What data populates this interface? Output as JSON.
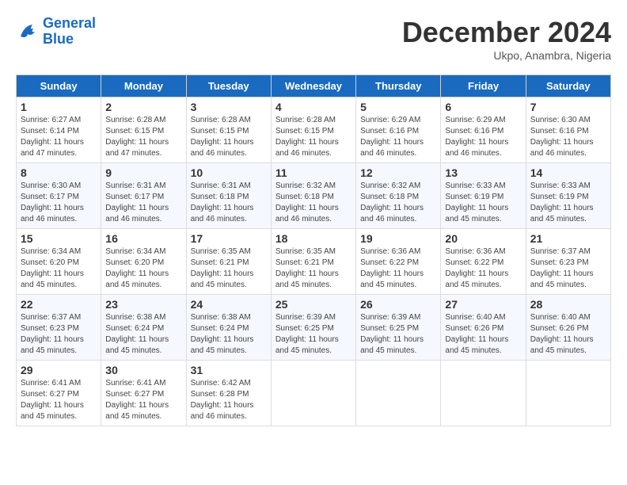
{
  "logo": {
    "line1": "General",
    "line2": "Blue"
  },
  "title": "December 2024",
  "subtitle": "Ukpo, Anambra, Nigeria",
  "weekdays": [
    "Sunday",
    "Monday",
    "Tuesday",
    "Wednesday",
    "Thursday",
    "Friday",
    "Saturday"
  ],
  "weeks": [
    [
      {
        "day": 1,
        "sunrise": "6:27 AM",
        "sunset": "6:14 PM",
        "daylight": "11 hours and 47 minutes."
      },
      {
        "day": 2,
        "sunrise": "6:28 AM",
        "sunset": "6:15 PM",
        "daylight": "11 hours and 47 minutes."
      },
      {
        "day": 3,
        "sunrise": "6:28 AM",
        "sunset": "6:15 PM",
        "daylight": "11 hours and 46 minutes."
      },
      {
        "day": 4,
        "sunrise": "6:28 AM",
        "sunset": "6:15 PM",
        "daylight": "11 hours and 46 minutes."
      },
      {
        "day": 5,
        "sunrise": "6:29 AM",
        "sunset": "6:16 PM",
        "daylight": "11 hours and 46 minutes."
      },
      {
        "day": 6,
        "sunrise": "6:29 AM",
        "sunset": "6:16 PM",
        "daylight": "11 hours and 46 minutes."
      },
      {
        "day": 7,
        "sunrise": "6:30 AM",
        "sunset": "6:16 PM",
        "daylight": "11 hours and 46 minutes."
      }
    ],
    [
      {
        "day": 8,
        "sunrise": "6:30 AM",
        "sunset": "6:17 PM",
        "daylight": "11 hours and 46 minutes."
      },
      {
        "day": 9,
        "sunrise": "6:31 AM",
        "sunset": "6:17 PM",
        "daylight": "11 hours and 46 minutes."
      },
      {
        "day": 10,
        "sunrise": "6:31 AM",
        "sunset": "6:18 PM",
        "daylight": "11 hours and 46 minutes."
      },
      {
        "day": 11,
        "sunrise": "6:32 AM",
        "sunset": "6:18 PM",
        "daylight": "11 hours and 46 minutes."
      },
      {
        "day": 12,
        "sunrise": "6:32 AM",
        "sunset": "6:18 PM",
        "daylight": "11 hours and 46 minutes."
      },
      {
        "day": 13,
        "sunrise": "6:33 AM",
        "sunset": "6:19 PM",
        "daylight": "11 hours and 45 minutes."
      },
      {
        "day": 14,
        "sunrise": "6:33 AM",
        "sunset": "6:19 PM",
        "daylight": "11 hours and 45 minutes."
      }
    ],
    [
      {
        "day": 15,
        "sunrise": "6:34 AM",
        "sunset": "6:20 PM",
        "daylight": "11 hours and 45 minutes."
      },
      {
        "day": 16,
        "sunrise": "6:34 AM",
        "sunset": "6:20 PM",
        "daylight": "11 hours and 45 minutes."
      },
      {
        "day": 17,
        "sunrise": "6:35 AM",
        "sunset": "6:21 PM",
        "daylight": "11 hours and 45 minutes."
      },
      {
        "day": 18,
        "sunrise": "6:35 AM",
        "sunset": "6:21 PM",
        "daylight": "11 hours and 45 minutes."
      },
      {
        "day": 19,
        "sunrise": "6:36 AM",
        "sunset": "6:22 PM",
        "daylight": "11 hours and 45 minutes."
      },
      {
        "day": 20,
        "sunrise": "6:36 AM",
        "sunset": "6:22 PM",
        "daylight": "11 hours and 45 minutes."
      },
      {
        "day": 21,
        "sunrise": "6:37 AM",
        "sunset": "6:23 PM",
        "daylight": "11 hours and 45 minutes."
      }
    ],
    [
      {
        "day": 22,
        "sunrise": "6:37 AM",
        "sunset": "6:23 PM",
        "daylight": "11 hours and 45 minutes."
      },
      {
        "day": 23,
        "sunrise": "6:38 AM",
        "sunset": "6:24 PM",
        "daylight": "11 hours and 45 minutes."
      },
      {
        "day": 24,
        "sunrise": "6:38 AM",
        "sunset": "6:24 PM",
        "daylight": "11 hours and 45 minutes."
      },
      {
        "day": 25,
        "sunrise": "6:39 AM",
        "sunset": "6:25 PM",
        "daylight": "11 hours and 45 minutes."
      },
      {
        "day": 26,
        "sunrise": "6:39 AM",
        "sunset": "6:25 PM",
        "daylight": "11 hours and 45 minutes."
      },
      {
        "day": 27,
        "sunrise": "6:40 AM",
        "sunset": "6:26 PM",
        "daylight": "11 hours and 45 minutes."
      },
      {
        "day": 28,
        "sunrise": "6:40 AM",
        "sunset": "6:26 PM",
        "daylight": "11 hours and 45 minutes."
      }
    ],
    [
      {
        "day": 29,
        "sunrise": "6:41 AM",
        "sunset": "6:27 PM",
        "daylight": "11 hours and 45 minutes."
      },
      {
        "day": 30,
        "sunrise": "6:41 AM",
        "sunset": "6:27 PM",
        "daylight": "11 hours and 45 minutes."
      },
      {
        "day": 31,
        "sunrise": "6:42 AM",
        "sunset": "6:28 PM",
        "daylight": "11 hours and 46 minutes."
      },
      null,
      null,
      null,
      null
    ]
  ]
}
